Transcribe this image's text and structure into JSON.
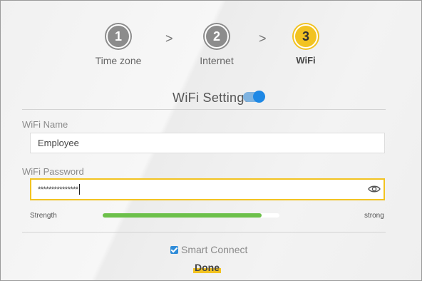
{
  "wizard": {
    "steps": [
      {
        "number": "1",
        "label": "Time zone"
      },
      {
        "number": "2",
        "label": "Internet"
      },
      {
        "number": "3",
        "label": "WiFi"
      }
    ],
    "separator": ">",
    "active_step": 3
  },
  "wifi_settings": {
    "title": "WiFi Settings",
    "enabled": true,
    "name_label": "WiFi Name",
    "name_value": "Employee",
    "password_label": "WiFi Password",
    "password_value": "***************",
    "strength_label": "Strength",
    "strength_text": "strong",
    "strength_level": 0.9,
    "smart_connect_label": "Smart Connect",
    "smart_connect_checked": true,
    "done_label": "Done"
  },
  "icons": {
    "eye": "eye-icon",
    "check": "checkbox-check-icon"
  },
  "colors": {
    "accent": "#f2c321",
    "inactive_step": "#8c8c8c",
    "toggle": "#1e88e5",
    "strength": "#6cc04a"
  }
}
